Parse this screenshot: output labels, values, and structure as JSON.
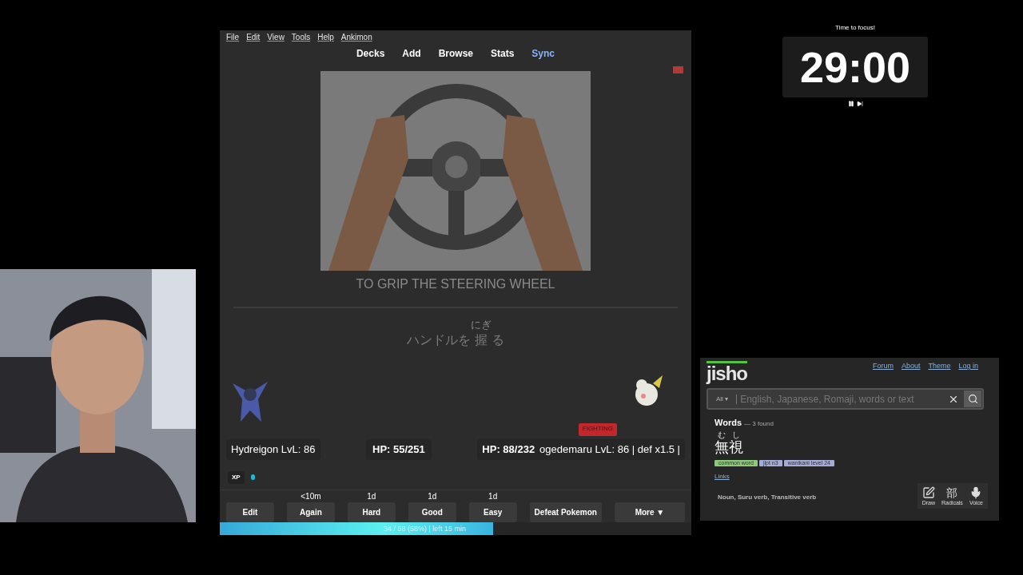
{
  "anki": {
    "menu": [
      "File",
      "Edit",
      "View",
      "Tools",
      "Help",
      "Ankimon"
    ],
    "nav": [
      {
        "label": "Decks",
        "highlighted": false
      },
      {
        "label": "Add",
        "highlighted": false
      },
      {
        "label": "Browse",
        "highlighted": false
      },
      {
        "label": "Stats",
        "highlighted": false
      },
      {
        "label": "Sync",
        "highlighted": true
      }
    ],
    "card": {
      "meaning": "TO GRIP THE STEERING WHEEL",
      "expression": [
        {
          "text": "ハンドルを"
        },
        {
          "text": "握",
          "reading": "にぎ"
        },
        {
          "text": "る"
        }
      ]
    },
    "battle": {
      "type_badge": "FIGHTING",
      "player": {
        "name": "Hydreigon LvL: 86",
        "hp": "HP: 55/251"
      },
      "opponent": {
        "hp": "HP: 88/232",
        "name": "ogedemaru LvL: 86 | def x1.5 |"
      },
      "xp_label": "XP"
    },
    "answer_buttons": [
      {
        "label": "Edit"
      },
      {
        "label": "Again",
        "interval": "<10m"
      },
      {
        "label": "Hard",
        "interval": "1d"
      },
      {
        "label": "Good",
        "interval": "1d"
      },
      {
        "label": "Easy",
        "interval": "1d"
      },
      {
        "label": "Defeat Pokemon"
      },
      {
        "label": "More ▼"
      }
    ],
    "progress": {
      "level": 0.58,
      "text": "34 / 58 (58%) | left 15 min"
    }
  },
  "timer": {
    "label": "Time to focus!",
    "time": "29:00"
  },
  "jisho": {
    "logo": "jisho",
    "links": [
      "Forum",
      "About",
      "Theme",
      "Log in"
    ],
    "search": {
      "scope": "All ▾",
      "placeholder": "English, Japanese, Romaji, words or text"
    },
    "heading": "Words",
    "count": "— 3 found",
    "word": {
      "furigana": [
        "む",
        "し"
      ],
      "text": "無視"
    },
    "tags": [
      {
        "label": "common word",
        "color": "#8cc97a"
      },
      {
        "label": "jlpt n3",
        "color": "#a3acd6"
      },
      {
        "label": "wanikani level 24",
        "color": "#a3acd6"
      }
    ],
    "links_label": "Links",
    "part_of_speech": "Noun, Suru verb, Transitive verb",
    "tools": [
      {
        "label": "Draw",
        "kind": "pen"
      },
      {
        "label": "Radicals",
        "kind": "glyph",
        "glyph": "部"
      },
      {
        "label": "Voice",
        "kind": "mic"
      }
    ]
  }
}
